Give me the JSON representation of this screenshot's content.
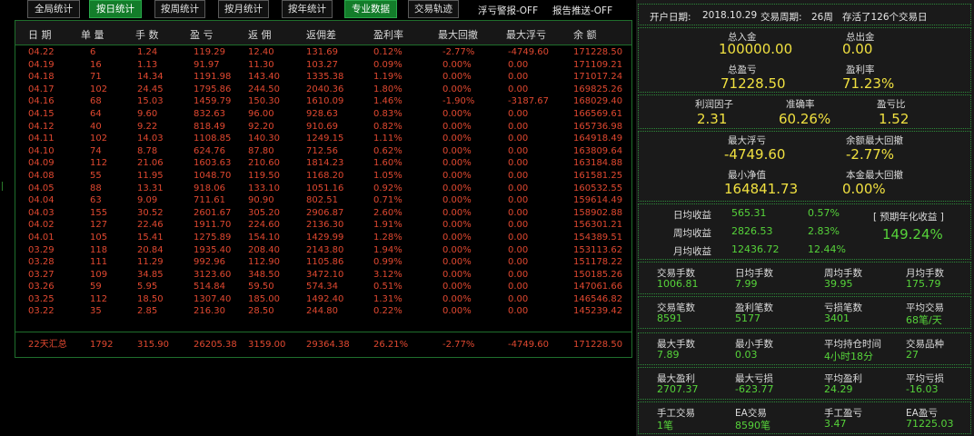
{
  "toolbar": {
    "buttons": [
      {
        "label": "全局统计",
        "active": false
      },
      {
        "label": "按日统计",
        "active": true
      },
      {
        "label": "按周统计",
        "active": false
      },
      {
        "label": "按月统计",
        "active": false
      },
      {
        "label": "按年统计",
        "active": false
      },
      {
        "label": "专业数据",
        "active": true
      },
      {
        "label": "交易轨迹",
        "active": false
      }
    ],
    "float_alert": "浮亏警报-OFF",
    "report_push": "报告推送-OFF"
  },
  "table": {
    "headers": [
      "日 期",
      "单 量",
      "手 数",
      "盈 亏",
      "返 佣",
      "返佣差",
      "盈利率",
      "最大回撤",
      "最大浮亏",
      "余 额"
    ],
    "rows": [
      [
        "04.22",
        "6",
        "1.24",
        "119.29",
        "12.40",
        "131.69",
        "0.12%",
        "-2.77%",
        "-4749.60",
        "171228.50"
      ],
      [
        "04.19",
        "16",
        "1.13",
        "91.97",
        "11.30",
        "103.27",
        "0.09%",
        "0.00%",
        "0.00",
        "171109.21"
      ],
      [
        "04.18",
        "71",
        "14.34",
        "1191.98",
        "143.40",
        "1335.38",
        "1.19%",
        "0.00%",
        "0.00",
        "171017.24"
      ],
      [
        "04.17",
        "102",
        "24.45",
        "1795.86",
        "244.50",
        "2040.36",
        "1.80%",
        "0.00%",
        "0.00",
        "169825.26"
      ],
      [
        "04.16",
        "68",
        "15.03",
        "1459.79",
        "150.30",
        "1610.09",
        "1.46%",
        "-1.90%",
        "-3187.67",
        "168029.40"
      ],
      [
        "04.15",
        "64",
        "9.60",
        "832.63",
        "96.00",
        "928.63",
        "0.83%",
        "0.00%",
        "0.00",
        "166569.61"
      ],
      [
        "04.12",
        "40",
        "9.22",
        "818.49",
        "92.20",
        "910.69",
        "0.82%",
        "0.00%",
        "0.00",
        "165736.98"
      ],
      [
        "04.11",
        "102",
        "14.03",
        "1108.85",
        "140.30",
        "1249.15",
        "1.11%",
        "0.00%",
        "0.00",
        "164918.49"
      ],
      [
        "04.10",
        "74",
        "8.78",
        "624.76",
        "87.80",
        "712.56",
        "0.62%",
        "0.00%",
        "0.00",
        "163809.64"
      ],
      [
        "04.09",
        "112",
        "21.06",
        "1603.63",
        "210.60",
        "1814.23",
        "1.60%",
        "0.00%",
        "0.00",
        "163184.88"
      ],
      [
        "04.08",
        "55",
        "11.95",
        "1048.70",
        "119.50",
        "1168.20",
        "1.05%",
        "0.00%",
        "0.00",
        "161581.25"
      ],
      [
        "04.05",
        "88",
        "13.31",
        "918.06",
        "133.10",
        "1051.16",
        "0.92%",
        "0.00%",
        "0.00",
        "160532.55"
      ],
      [
        "04.04",
        "63",
        "9.09",
        "711.61",
        "90.90",
        "802.51",
        "0.71%",
        "0.00%",
        "0.00",
        "159614.49"
      ],
      [
        "04.03",
        "155",
        "30.52",
        "2601.67",
        "305.20",
        "2906.87",
        "2.60%",
        "0.00%",
        "0.00",
        "158902.88"
      ],
      [
        "04.02",
        "127",
        "22.46",
        "1911.70",
        "224.60",
        "2136.30",
        "1.91%",
        "0.00%",
        "0.00",
        "156301.21"
      ],
      [
        "04.01",
        "105",
        "15.41",
        "1275.89",
        "154.10",
        "1429.99",
        "1.28%",
        "0.00%",
        "0.00",
        "154389.51"
      ],
      [
        "03.29",
        "118",
        "20.84",
        "1935.40",
        "208.40",
        "2143.80",
        "1.94%",
        "0.00%",
        "0.00",
        "153113.62"
      ],
      [
        "03.28",
        "111",
        "11.29",
        "992.96",
        "112.90",
        "1105.86",
        "0.99%",
        "0.00%",
        "0.00",
        "151178.22"
      ],
      [
        "03.27",
        "109",
        "34.85",
        "3123.60",
        "348.50",
        "3472.10",
        "3.12%",
        "0.00%",
        "0.00",
        "150185.26"
      ],
      [
        "03.26",
        "59",
        "5.95",
        "514.84",
        "59.50",
        "574.34",
        "0.51%",
        "0.00%",
        "0.00",
        "147061.66"
      ],
      [
        "03.25",
        "112",
        "18.50",
        "1307.40",
        "185.00",
        "1492.40",
        "1.31%",
        "0.00%",
        "0.00",
        "146546.82"
      ],
      [
        "03.22",
        "35",
        "2.85",
        "216.30",
        "28.50",
        "244.80",
        "0.22%",
        "0.00%",
        "0.00",
        "145239.42"
      ]
    ],
    "summary": [
      "22天汇总",
      "1792",
      "315.90",
      "26205.38",
      "3159.00",
      "29364.38",
      "26.21%",
      "-2.77%",
      "-4749.60",
      "171228.50"
    ]
  },
  "right": {
    "header": {
      "open_date_label": "开户日期:",
      "open_date": "2018.10.29",
      "period_label": "交易周期:",
      "period": "26周",
      "stored": "存活了126个交易日"
    },
    "deposit": {
      "label": "总入金",
      "value": "100000.00"
    },
    "withdraw": {
      "label": "总出金",
      "value": "0.00"
    },
    "total_pl": {
      "label": "总盈亏",
      "value": "71228.50"
    },
    "profit_rate": {
      "label": "盈利率",
      "value": "71.23%"
    },
    "profit_factor": {
      "label": "利润因子",
      "value": "2.31"
    },
    "accuracy": {
      "label": "准确率",
      "value": "60.26%"
    },
    "pl_ratio": {
      "label": "盈亏比",
      "value": "1.52"
    },
    "max_float": {
      "label": "最大浮亏",
      "value": "-4749.60"
    },
    "max_dd_balance": {
      "label": "余额最大回撤",
      "value": "-2.77%"
    },
    "min_equity": {
      "label": "最小净值",
      "value": "164841.73"
    },
    "max_dd_principal": {
      "label": "本金最大回撤",
      "value": "0.00%"
    },
    "avg": {
      "daily": {
        "label": "日均收益",
        "value": "565.31",
        "pct": "0.57%"
      },
      "weekly": {
        "label": "周均收益",
        "value": "2826.53",
        "pct": "2.83%"
      },
      "monthly": {
        "label": "月均收益",
        "value": "12436.72",
        "pct": "12.44%"
      },
      "annual_label": "[ 预期年化收益 ]",
      "annual_value": "149.24%"
    },
    "stats": [
      [
        {
          "label": "交易手数",
          "value": "1006.81"
        },
        {
          "label": "日均手数",
          "value": "7.99"
        },
        {
          "label": "周均手数",
          "value": "39.95"
        },
        {
          "label": "月均手数",
          "value": "175.79"
        }
      ],
      [
        {
          "label": "交易笔数",
          "value": "8591"
        },
        {
          "label": "盈利笔数",
          "value": "5177"
        },
        {
          "label": "亏损笔数",
          "value": "3401"
        },
        {
          "label": "平均交易",
          "value": "68笔/天"
        }
      ],
      [
        {
          "label": "最大手数",
          "value": "7.89"
        },
        {
          "label": "最小手数",
          "value": "0.03"
        },
        {
          "label": "平均持仓时间",
          "value": "4小时18分"
        },
        {
          "label": "交易品种",
          "value": "27"
        }
      ],
      [
        {
          "label": "最大盈利",
          "value": "2707.37"
        },
        {
          "label": "最大亏损",
          "value": "-623.77"
        },
        {
          "label": "平均盈利",
          "value": "24.29"
        },
        {
          "label": "平均亏损",
          "value": "-16.03"
        }
      ],
      [
        {
          "label": "手工交易",
          "value": "1笔"
        },
        {
          "label": "EA交易",
          "value": "8590笔"
        },
        {
          "label": "手工盈亏",
          "value": "3.47"
        },
        {
          "label": "EA盈亏",
          "value": "71225.03"
        }
      ]
    ]
  }
}
